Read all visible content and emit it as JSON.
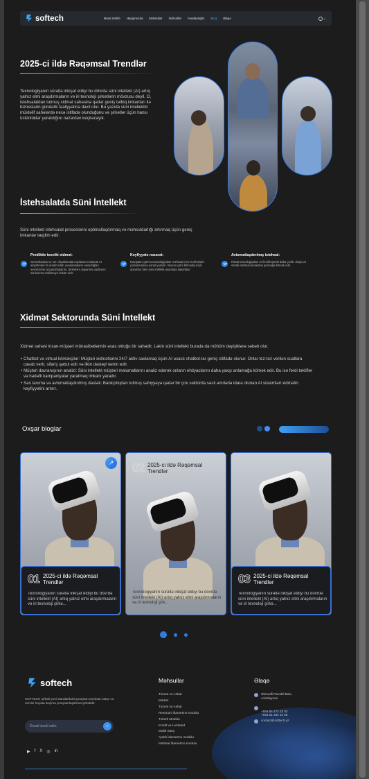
{
  "nav": {
    "brand": "softech",
    "links": [
      "Əsas Səhifə",
      "Haqqımızda",
      "Məhsullar",
      "Xidmətlər",
      "Avadanlıqlar",
      "Bloq",
      "Əlaqə"
    ],
    "active": "Bloq",
    "lang": "⌄"
  },
  "hero": {
    "title": "2025-ci ildə Rəqəmsal Trendlər",
    "text": "Texnologiyanın sürətlə inkişaf etdiyi bu dövrdə süni intellekt (AI) artıq yalnız elmi araşdırmaların və iri texnoloji şirkətlərin mövzusu deyil. O, istehsalatdan tutmuş xidmət sahəsinə qədər geniş tətbiq imkanları ilə bizneslərin gündəlik fəaliyyətinə daxil olur. Bu yazıda süni intellektin müxtəlif sahələrdə necə istifadə olunduğunu və şirkətlər üçün hansı üstünlüklər yaratdığını nəzərdən keçirəcəyik."
  },
  "industry": {
    "title": "İstehsalatda Süni İntellekt",
    "text": "Süni intellekt istehsalat proseslərini optimallaşdırmaq və məhsuldarlığı artırmaq üçün geniş imkanlar təqdim edir.",
    "features": [
      {
        "title": "Prediktiv texniki xidmət:",
        "text": "Sensorlardan və IoT cihazlarından toplanan məlumat AI alqoritmləri ilə analiz edilir, avadanlıqların nasazlığları əvvəlcədən proqnozlaşdırılır. Şirkətlərə dayanma vaxtlarını minimuma endirməyə imkan verir."
      },
      {
        "title": "Keyfiyyətə nəzarət:",
        "text": "Kompüter görmə texnologiyaları məhsulun hər mərhələdə yoxlanmasına şərait yaradır. İnsanın görə bilmədiyi kiçik qüsurları belə süni intellekt asanlıqla aşkarlayır."
      },
      {
        "title": "Avtomatlaşdırılmış istehsal:",
        "text": "Robot texnologiyaları AI ilə birləşərək daha çevik, dəqiq və sürətli istehsal prosesləri qurmağa kömək edir."
      }
    ]
  },
  "service": {
    "title": "Xidmət Sektorunda Süni İntellekt",
    "intro": "Xidmət sahəsi insan-müştəri münasibətlərinin əsas olduğu bir sahədir. Lakin süni intellekt burada da mühüm dəyişiklərə səbəb olur.",
    "bullets": [
      "Chatbot və virtual köməkçilər: Müştəri xidmətlərini 24/7 aktiv saxlamaq üçün AI əsaslı chatbot-lar geniş istifadə olunur. Onlar tez-tez verilən suallara cavab verir, sifariş qəbul edir və ilkin dəstəyi təmin edir.",
      "Müştəri davranışının analizi: Süni intellekt müştəri məlumatlarını analiz edərək onların ehtiyaclarını daha yaxşı anlamağa kömək edir. Bu isə fərdi təkliflər və hədəfli kampaniyalar yaratmaq imkanı yaradır.",
      "Səs tanıma və avtomatlaşdırılmış dəstək: Bankçılıqdan tutmuş səhiyyəyə qədər bir çox sektorda səsli əmrlərlə idarə olunan AI sistemləri xidmətin keyfiyyətini artırır."
    ]
  },
  "similar": {
    "title": "Oxşar bloglar",
    "cards": [
      {
        "num": "01",
        "title": "2025-ci ildə Rəqəmsal Trendlər",
        "text": "Texnologiyanın sürətlə inkişaf etdiyi bu dövrdə süni intellekt (AI) artıq yalnız elmi araşdırmaların və iri texnoloji şirkə..."
      },
      {
        "num": "02",
        "title": "2025-ci ildə Rəqəmsal Trendlər",
        "text": "Texnologiyanın sürətlə inkişaf etdiyi bu dövrdə süni intellekt (AI) artıq yalnız elmi araşdırmaların və iri texnoloji şirk..."
      },
      {
        "num": "03",
        "title": "2025-ci ildə Rəqəmsal Trendlər",
        "text": "Texnologiyanın sürətlə inkişaf etdiyi bu dövrdə süni intellekt (AI) artıq yalnız elmi araşdırmaların və iri texnoloji şirkə..."
      }
    ],
    "arrow": "↗"
  },
  "footer": {
    "brand": "softech",
    "desc": "SOFTECH şirkəti yeni standartlarla proqram təminatı satışı və servisi həyata keçirən proqramlaşdırma şirkətidir.",
    "email_placeholder": "Email daxil edin",
    "email_go": "»",
    "products_title": "Məhsullar",
    "products": [
      "Ticarət və Anbar",
      "Market",
      "Ticarət və Anbar",
      "Restoran İdarəetmə modulu",
      "Təkərli Modulu",
      "Kredit və Lombard",
      "Mobil Satış",
      "Aptek idarəetmə modulu",
      "İstehsal İdarəetmə modulu"
    ],
    "contact_title": "Əlaqə",
    "address": "Əhmədli Rəcəbli Bakı, Azərbaycan",
    "phones": "+994 55 274 23 03\n+994 51 282 15 56",
    "email": "contact@softech.az",
    "social": [
      "▶",
      "f",
      "X",
      "◎",
      "in"
    ]
  },
  "colors": {
    "accent": "#3fa4f5",
    "bg": "#1c1c1d",
    "card_border": "#3b6fd4"
  }
}
